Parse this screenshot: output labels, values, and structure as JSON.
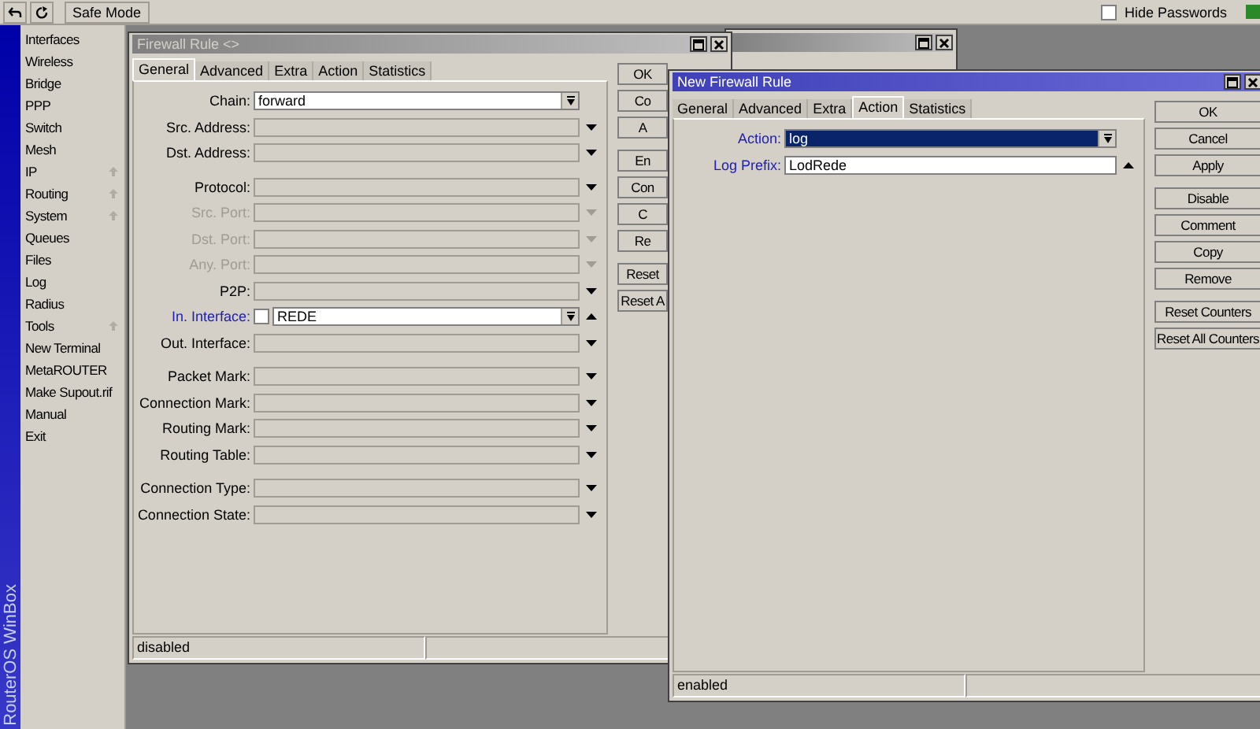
{
  "toolbar": {
    "safe_mode": "Safe Mode",
    "hide_passwords": {
      "label": "Hide Passwords",
      "checked": false
    }
  },
  "sidebar": {
    "brand": "RouterOS WinBox",
    "items": [
      {
        "label": "Interfaces",
        "submenu": false
      },
      {
        "label": "Wireless",
        "submenu": false
      },
      {
        "label": "Bridge",
        "submenu": false
      },
      {
        "label": "PPP",
        "submenu": false
      },
      {
        "label": "Switch",
        "submenu": false
      },
      {
        "label": "Mesh",
        "submenu": false
      },
      {
        "label": "IP",
        "submenu": true
      },
      {
        "label": "Routing",
        "submenu": true
      },
      {
        "label": "System",
        "submenu": true
      },
      {
        "label": "Queues",
        "submenu": false
      },
      {
        "label": "Files",
        "submenu": false
      },
      {
        "label": "Log",
        "submenu": false
      },
      {
        "label": "Radius",
        "submenu": false
      },
      {
        "label": "Tools",
        "submenu": true
      },
      {
        "label": "New Terminal",
        "submenu": false
      },
      {
        "label": "MetaROUTER",
        "submenu": false
      },
      {
        "label": "Make Supout.rif",
        "submenu": false
      },
      {
        "label": "Manual",
        "submenu": false
      },
      {
        "label": "Exit",
        "submenu": false
      }
    ]
  },
  "windows": [
    {
      "title": "Firewall Rule <>",
      "active": false,
      "tabs": [
        {
          "label": "General",
          "selected": true
        },
        {
          "label": "Advanced",
          "selected": false
        },
        {
          "label": "Extra",
          "selected": false
        },
        {
          "label": "Action",
          "selected": false
        },
        {
          "label": "Statistics",
          "selected": false
        }
      ],
      "field_groups": [
        [
          {
            "label": "Chain:",
            "kind": "combo",
            "value": "forward",
            "disabled": false,
            "modified": false,
            "selected": false
          },
          {
            "label": "Src. Address:",
            "kind": "optional",
            "disabled": false,
            "modified": false,
            "selected": false
          },
          {
            "label": "Dst. Address:",
            "kind": "optional",
            "disabled": false,
            "modified": false,
            "selected": false
          }
        ],
        [
          {
            "label": "Protocol:",
            "kind": "optional",
            "disabled": false,
            "modified": false,
            "selected": false
          },
          {
            "label": "Src. Port:",
            "kind": "optional",
            "disabled": true,
            "modified": false,
            "selected": false
          },
          {
            "label": "Dst. Port:",
            "kind": "optional",
            "disabled": true,
            "modified": false,
            "selected": false
          },
          {
            "label": "Any. Port:",
            "kind": "optional",
            "disabled": true,
            "modified": false,
            "selected": false
          },
          {
            "label": "P2P:",
            "kind": "optional",
            "disabled": false,
            "modified": false,
            "selected": false
          },
          {
            "label": "In. Interface:",
            "kind": "invertible",
            "value": "REDE",
            "inverted": false,
            "disabled": false,
            "modified": true,
            "selected": false
          },
          {
            "label": "Out. Interface:",
            "kind": "optional",
            "disabled": false,
            "modified": false,
            "selected": false
          }
        ],
        [
          {
            "label": "Packet Mark:",
            "kind": "optional",
            "disabled": false,
            "modified": false,
            "selected": false
          },
          {
            "label": "Connection Mark:",
            "kind": "optional",
            "disabled": false,
            "modified": false,
            "selected": false
          },
          {
            "label": "Routing Mark:",
            "kind": "optional",
            "disabled": false,
            "modified": false,
            "selected": false
          },
          {
            "label": "Routing Table:",
            "kind": "optional",
            "disabled": false,
            "modified": false,
            "selected": false
          }
        ],
        [
          {
            "label": "Connection Type:",
            "kind": "optional",
            "disabled": false,
            "modified": false,
            "selected": false
          },
          {
            "label": "Connection State:",
            "kind": "optional",
            "disabled": false,
            "modified": false,
            "selected": false
          }
        ]
      ],
      "button_groups": [
        [
          "OK",
          "Co",
          "A"
        ],
        [
          "En",
          "Con",
          "C",
          "Re"
        ],
        [
          "Reset",
          "Reset A"
        ]
      ],
      "status": [
        "disabled"
      ]
    },
    {
      "title": "New Firewall Rule",
      "active": true,
      "tabs": [
        {
          "label": "General",
          "selected": false
        },
        {
          "label": "Advanced",
          "selected": false
        },
        {
          "label": "Extra",
          "selected": false
        },
        {
          "label": "Action",
          "selected": true
        },
        {
          "label": "Statistics",
          "selected": false
        }
      ],
      "field_groups": [
        [
          {
            "label": "Action:",
            "kind": "combo",
            "value": "log",
            "disabled": false,
            "modified": true,
            "selected": true
          },
          {
            "label": "Log Prefix:",
            "kind": "text",
            "value": "LodRede",
            "disabled": false,
            "modified": true,
            "selected": false
          }
        ]
      ],
      "button_groups": [
        [
          "OK",
          "Cancel",
          "Apply"
        ],
        [
          "Disable",
          "Comment",
          "Copy",
          "Remove"
        ],
        [
          "Reset Counters",
          "Reset All Counters"
        ]
      ],
      "status": [
        "enabled"
      ]
    }
  ]
}
